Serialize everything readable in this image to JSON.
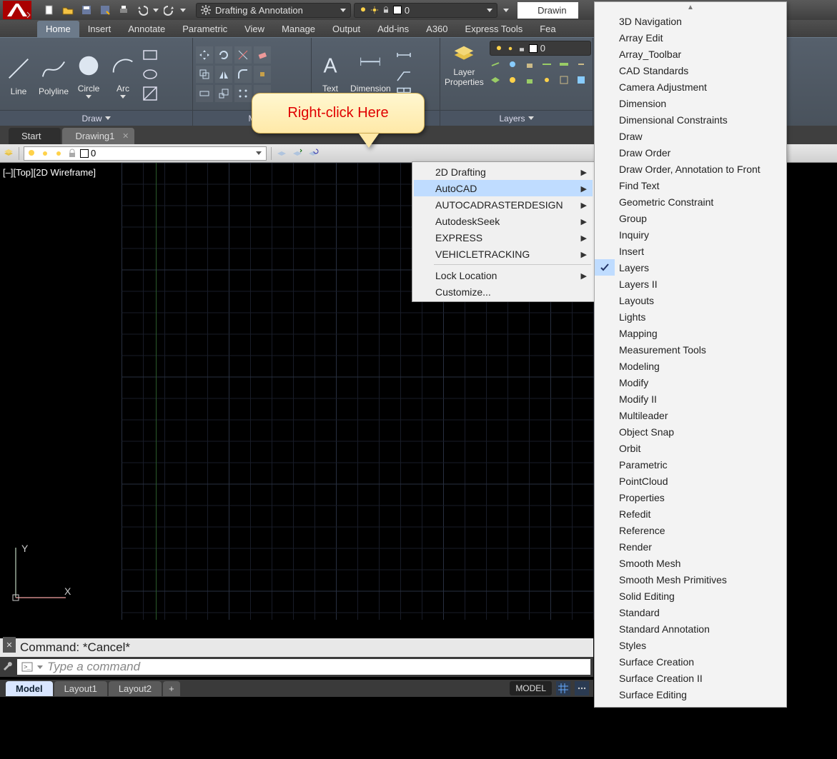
{
  "titlebar": {
    "workspace": "Drafting & Annotation",
    "layer0": "0",
    "filetab": "Drawin"
  },
  "ribbon": {
    "tabs": [
      "Home",
      "Insert",
      "Annotate",
      "Parametric",
      "View",
      "Manage",
      "Output",
      "Add-ins",
      "A360",
      "Express Tools",
      "Fea"
    ],
    "active": 0,
    "draw": {
      "title": "Draw",
      "line": "Line",
      "polyline": "Polyline",
      "circle": "Circle",
      "arc": "Arc"
    },
    "annot": {
      "text": "Text",
      "dim": "Dimension"
    },
    "layers": {
      "title": "Layers",
      "prop": "Layer\nProperties",
      "combo": "0"
    }
  },
  "dwg_tabs": {
    "start": "Start",
    "active": "Drawing1"
  },
  "aux_layer": "0",
  "vp_label": "[–][Top][2D Wireframe]",
  "callout": "Right-click Here",
  "context_menu": {
    "items": [
      {
        "label": "2D Drafting",
        "sub": true
      },
      {
        "label": "AutoCAD",
        "sub": true,
        "hl": true
      },
      {
        "label": "AUTOCADRASTERDESIGN",
        "sub": true
      },
      {
        "label": "AutodeskSeek",
        "sub": true
      },
      {
        "label": "EXPRESS",
        "sub": true
      },
      {
        "label": "VEHICLETRACKING",
        "sub": true
      }
    ],
    "items2": [
      {
        "label": "Lock Location",
        "sub": true
      },
      {
        "label": "Customize..."
      }
    ]
  },
  "toolbar_list": [
    "3D Navigation",
    "Array Edit",
    "Array_Toolbar",
    "CAD Standards",
    "Camera Adjustment",
    "Dimension",
    "Dimensional Constraints",
    "Draw",
    "Draw Order",
    "Draw Order, Annotation to Front",
    "Find Text",
    "Geometric Constraint",
    "Group",
    "Inquiry",
    "Insert",
    "Layers",
    "Layers II",
    "Layouts",
    "Lights",
    "Mapping",
    "Measurement Tools",
    "Modeling",
    "Modify",
    "Modify II",
    "Multileader",
    "Object Snap",
    "Orbit",
    "Parametric",
    "PointCloud",
    "Properties",
    "Refedit",
    "Reference",
    "Render",
    "Smooth Mesh",
    "Smooth Mesh Primitives",
    "Solid Editing",
    "Standard",
    "Standard Annotation",
    "Styles",
    "Surface Creation",
    "Surface Creation II",
    "Surface Editing"
  ],
  "toolbar_checked": "Layers",
  "cmd": {
    "hist": "Command: *Cancel*",
    "placeholder": "Type a command"
  },
  "layout_tabs": [
    "Model",
    "Layout1",
    "Layout2"
  ],
  "status_model": "MODEL",
  "ucs": {
    "x": "X",
    "y": "Y"
  }
}
